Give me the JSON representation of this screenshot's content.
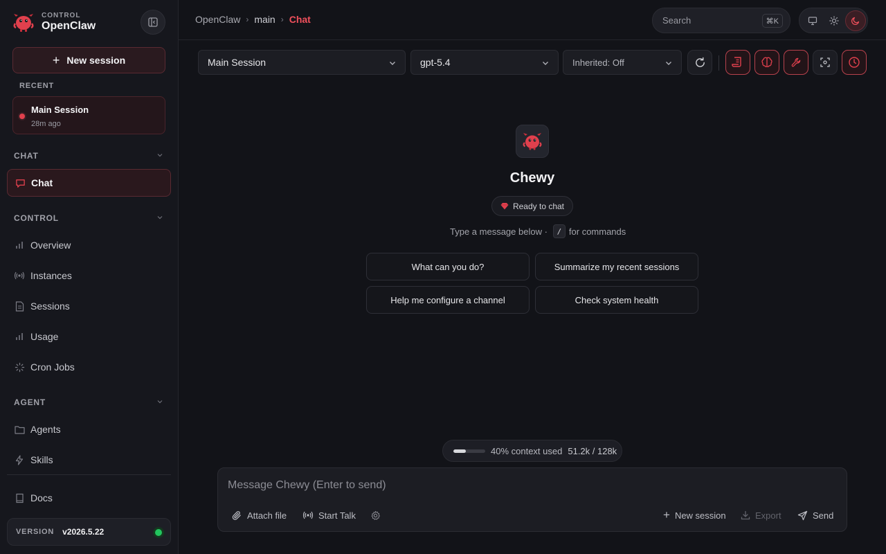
{
  "brand": {
    "small": "CONTROL",
    "name": "OpenClaw"
  },
  "sidebar": {
    "new_session_label": "New session",
    "recent_label": "RECENT",
    "recent": [
      {
        "title": "Main Session",
        "time": "28m ago"
      }
    ],
    "sections": [
      {
        "label": "CHAT",
        "items": [
          {
            "label": "Chat",
            "icon": "message-icon",
            "active": true
          }
        ]
      },
      {
        "label": "CONTROL",
        "items": [
          {
            "label": "Overview",
            "icon": "bar-chart-icon"
          },
          {
            "label": "Instances",
            "icon": "broadcast-icon"
          },
          {
            "label": "Sessions",
            "icon": "document-icon"
          },
          {
            "label": "Usage",
            "icon": "bar-chart-icon"
          },
          {
            "label": "Cron Jobs",
            "icon": "loader-icon"
          }
        ]
      },
      {
        "label": "AGENT",
        "items": [
          {
            "label": "Agents",
            "icon": "folder-icon"
          },
          {
            "label": "Skills",
            "icon": "lightning-icon"
          }
        ]
      }
    ],
    "docs_label": "Docs",
    "version_label": "VERSION",
    "version_value": "v2026.5.22",
    "status_color": "#22c55e"
  },
  "header": {
    "breadcrumb": [
      "OpenClaw",
      "main",
      "Chat"
    ],
    "search_placeholder": "Search",
    "search_shortcut": "⌘K",
    "theme_active": "dark"
  },
  "toolbar": {
    "session_select": "Main Session",
    "model_select": "gpt-5.4",
    "inherited_select": "Inherited: Off"
  },
  "empty_state": {
    "agent_name": "Chewy",
    "status": "Ready to chat",
    "hint_before": "Type a message below ·",
    "hint_key": "/",
    "hint_after": "for commands",
    "suggestions": [
      "What can you do?",
      "Summarize my recent sessions",
      "Help me configure a channel",
      "Check system health"
    ]
  },
  "context": {
    "percent": 40,
    "label": "40% context used",
    "tokens": "51.2k / 128k"
  },
  "composer": {
    "placeholder": "Message Chewy (Enter to send)",
    "attach_label": "Attach file",
    "talk_label": "Start Talk",
    "new_session_label": "New session",
    "export_label": "Export",
    "send_label": "Send"
  },
  "colors": {
    "accent": "#e0404d",
    "background": "#121318",
    "sidebar": "#16171d"
  }
}
